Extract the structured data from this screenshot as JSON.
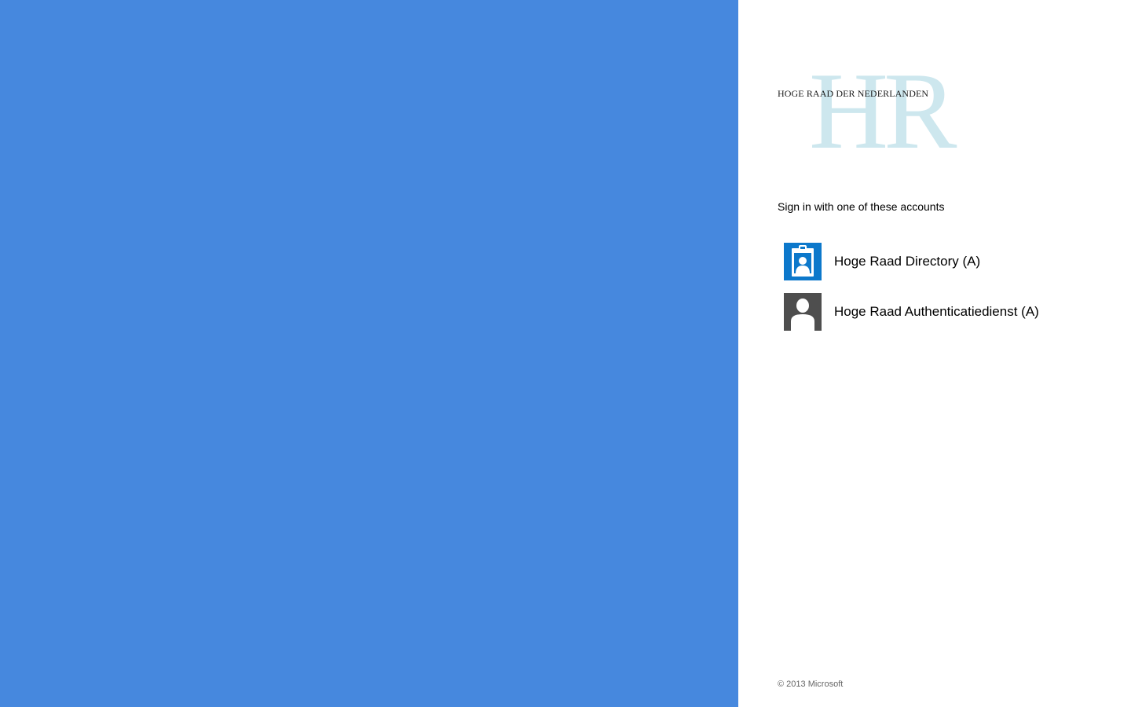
{
  "colors": {
    "illustration_background": "#4688de",
    "logo_letters": "#cde7ee",
    "directory_icon_background": "#0c78cb",
    "auth_icon_background": "#4e4e4e"
  },
  "logo": {
    "letters": "HR",
    "wordmark": "HOGE RAAD DER NEDERLANDEN"
  },
  "sign_in": {
    "prompt": "Sign in with one of these accounts",
    "accounts": [
      {
        "label": "Hoge Raad Directory (A)",
        "icon": "id-badge-icon"
      },
      {
        "label": "Hoge Raad Authenticatiedienst (A)",
        "icon": "user-silhouette-icon"
      }
    ]
  },
  "footer": {
    "copyright": "© 2013 Microsoft"
  }
}
